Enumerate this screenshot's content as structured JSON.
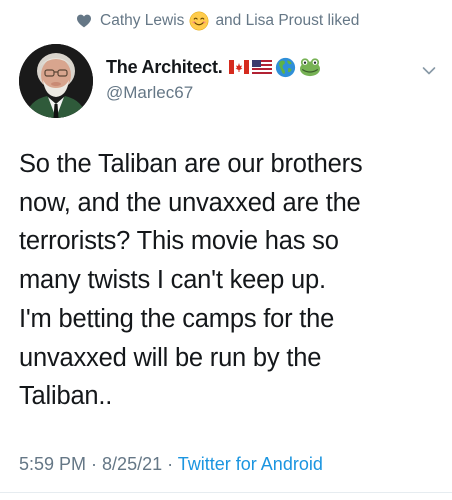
{
  "social_context": {
    "first_user": "Cathy Lewis",
    "rest": "and Lisa Proust liked",
    "icon": "heart-icon",
    "emoji": "smiling-face-emoji"
  },
  "author": {
    "display_name": "The Architect.",
    "handle": "@Marlec67",
    "name_emojis": [
      "canada-flag",
      "usa-flag",
      "globe-americas",
      "frog-face"
    ]
  },
  "tweet": {
    "lines": [
      "So the Taliban are our brothers",
      "now, and the unvaxxed are the",
      "terrorists? This movie has so",
      "many twists I can't keep up.",
      "I'm betting the camps for the",
      "unvaxxed will be run by the",
      "Taliban.."
    ]
  },
  "meta": {
    "time": "5:59 PM",
    "separator": " · ",
    "date": "8/25/21",
    "source": "Twitter for Android"
  },
  "colors": {
    "text_primary": "#14171a",
    "text_secondary": "#657786",
    "link": "#1b95e0",
    "divider": "#e6ecf0"
  }
}
